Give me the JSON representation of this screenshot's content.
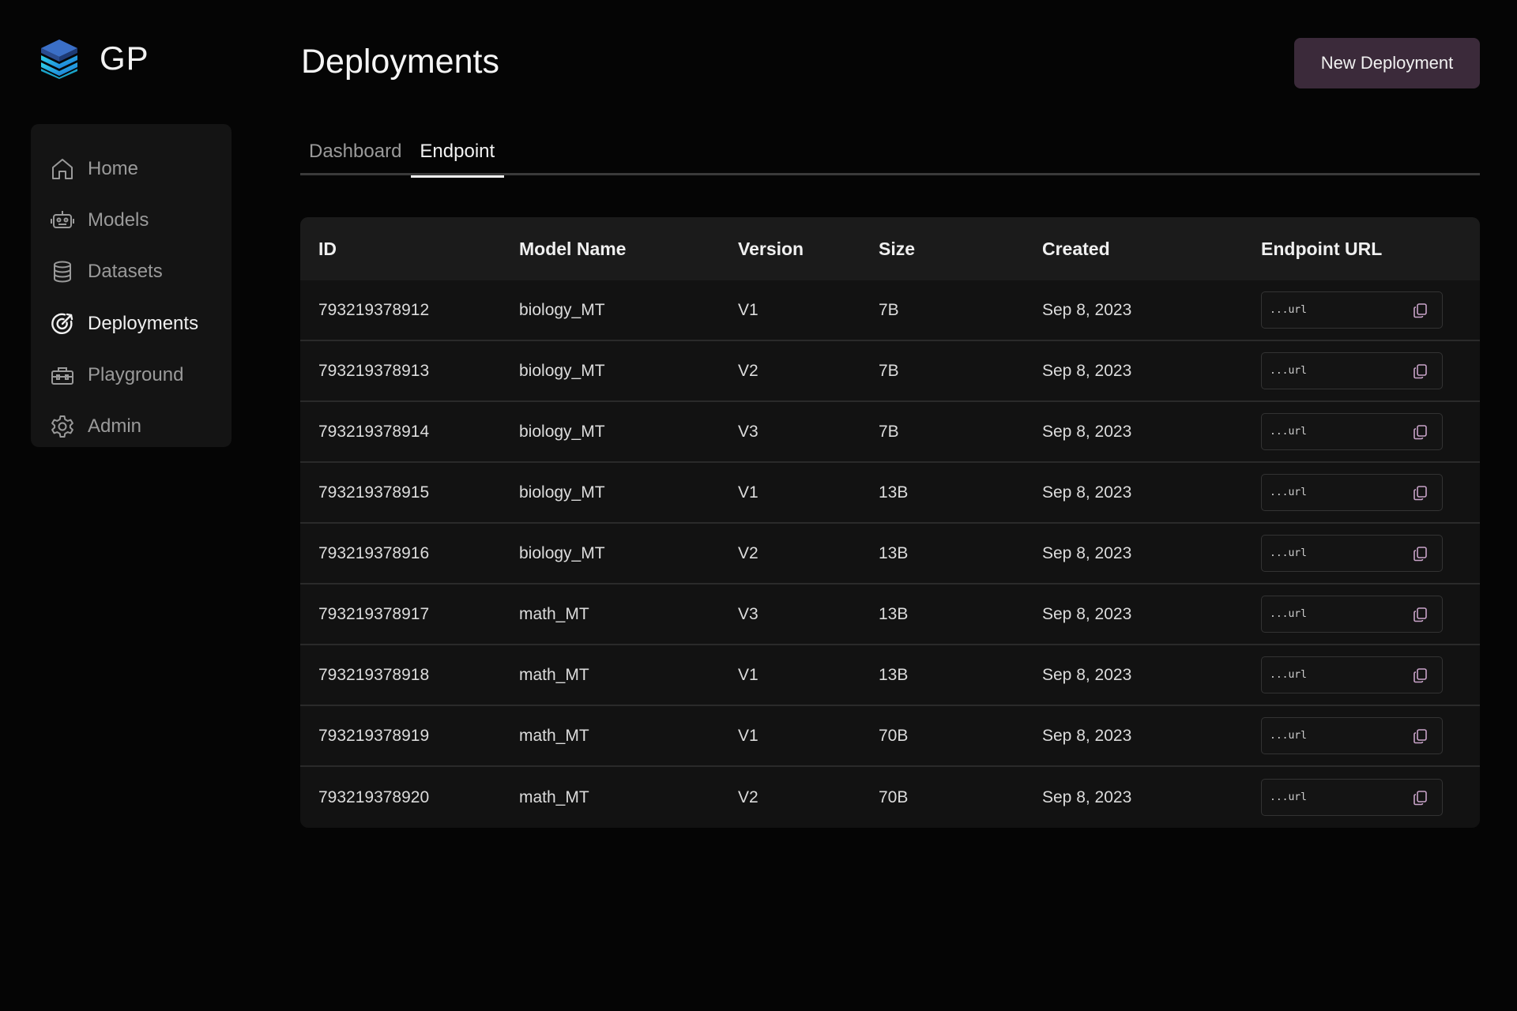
{
  "brand": {
    "name": "GP",
    "logo_icon": "stacked-layers-icon"
  },
  "sidebar": {
    "items": [
      {
        "label": "Home",
        "icon": "home-icon",
        "active": false
      },
      {
        "label": "Models",
        "icon": "robot-icon",
        "active": false
      },
      {
        "label": "Datasets",
        "icon": "database-icon",
        "active": false
      },
      {
        "label": "Deployments",
        "icon": "target-icon",
        "active": true
      },
      {
        "label": "Playground",
        "icon": "toolbox-icon",
        "active": false
      },
      {
        "label": "Admin",
        "icon": "gear-icon",
        "active": false
      }
    ]
  },
  "header": {
    "title": "Deployments",
    "new_button_label": "New Deployment"
  },
  "tabs": [
    {
      "label": "Dashboard",
      "active": false
    },
    {
      "label": "Endpoint",
      "active": true
    }
  ],
  "table": {
    "columns": [
      "ID",
      "Model Name",
      "Version",
      "Size",
      "Created",
      "Endpoint URL"
    ],
    "rows": [
      {
        "id": "793219378912",
        "model": "biology_MT",
        "version": "V1",
        "size": "7B",
        "created": "Sep 8, 2023",
        "url": "...url"
      },
      {
        "id": "793219378913",
        "model": "biology_MT",
        "version": "V2",
        "size": "7B",
        "created": "Sep 8, 2023",
        "url": "...url"
      },
      {
        "id": "793219378914",
        "model": "biology_MT",
        "version": "V3",
        "size": "7B",
        "created": "Sep 8, 2023",
        "url": "...url"
      },
      {
        "id": "793219378915",
        "model": "biology_MT",
        "version": "V1",
        "size": "13B",
        "created": "Sep 8, 2023",
        "url": "...url"
      },
      {
        "id": "793219378916",
        "model": "biology_MT",
        "version": "V2",
        "size": "13B",
        "created": "Sep 8, 2023",
        "url": "...url"
      },
      {
        "id": "793219378917",
        "model": "math_MT",
        "version": "V3",
        "size": "13B",
        "created": "Sep 8, 2023",
        "url": "...url"
      },
      {
        "id": "793219378918",
        "model": "math_MT",
        "version": "V1",
        "size": "13B",
        "created": "Sep 8, 2023",
        "url": "...url"
      },
      {
        "id": "793219378919",
        "model": "math_MT",
        "version": "V1",
        "size": "70B",
        "created": "Sep 8, 2023",
        "url": "...url"
      },
      {
        "id": "793219378920",
        "model": "math_MT",
        "version": "V2",
        "size": "70B",
        "created": "Sep 8, 2023",
        "url": "...url"
      }
    ]
  },
  "colors": {
    "background": "#050505",
    "sidebar": "#141414",
    "button": "#3b2a3a",
    "copy_icon": "#c9a3c9"
  }
}
